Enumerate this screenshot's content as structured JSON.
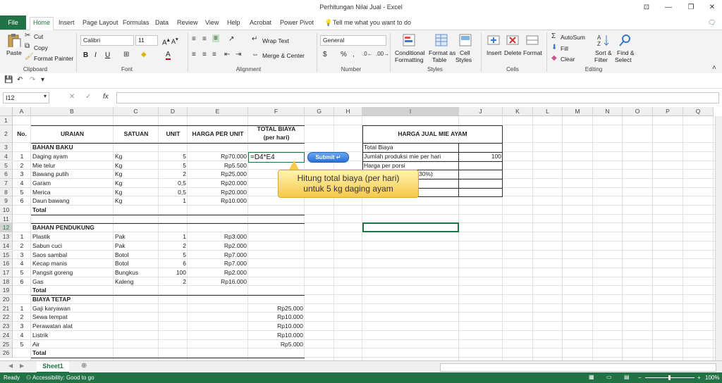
{
  "window": {
    "title": "Perhitungan Nilai Jual  -  Excel"
  },
  "tabs": [
    "File",
    "Home",
    "Insert",
    "Page Layout",
    "Formulas",
    "Data",
    "Review",
    "View",
    "Help",
    "Acrobat",
    "Power Pivot"
  ],
  "tell_me": "Tell me what you want to do",
  "ribbon": {
    "clipboard": {
      "label": "Clipboard",
      "paste": "Paste",
      "cut": "Cut",
      "copy": "Copy",
      "format_painter": "Format Painter"
    },
    "font": {
      "label": "Font",
      "name": "Calibri",
      "size": "11",
      "bold": "B",
      "italic": "I",
      "underline": "U"
    },
    "alignment": {
      "label": "Alignment",
      "wrap": "Wrap Text",
      "merge": "Merge & Center"
    },
    "number": {
      "label": "Number",
      "format": "General"
    },
    "styles": {
      "label": "Styles",
      "conditional": "Conditional",
      "formatting": "Formatting",
      "format_as": "Format as",
      "table": "Table",
      "cell": "Cell",
      "cell_styles": "Styles"
    },
    "cells": {
      "label": "Cells",
      "insert": "Insert",
      "delete": "Delete",
      "format": "Format"
    },
    "editing": {
      "label": "Editing",
      "autosum": "AutoSum",
      "fill": "Fill",
      "clear": "Clear",
      "sort": "Sort &",
      "filter": "Filter",
      "find": "Find &",
      "select": "Select"
    }
  },
  "namebox": "I12",
  "fx": "fx",
  "columns": [
    "A",
    "B",
    "C",
    "D",
    "E",
    "F",
    "G",
    "H",
    "I",
    "J",
    "K",
    "L",
    "M",
    "N",
    "O",
    "P",
    "Q"
  ],
  "rows": [
    "1",
    "2",
    "3",
    "4",
    "5",
    "6",
    "7",
    "8",
    "9",
    "10",
    "11",
    "12",
    "13",
    "14",
    "15",
    "16",
    "17",
    "18",
    "19",
    "20",
    "21",
    "22",
    "23",
    "24",
    "25",
    "26"
  ],
  "headers": {
    "no": "No.",
    "uraian": "URAIAN",
    "satuan": "SATUAN",
    "unit": "UNIT",
    "harga": "HARGA PER UNIT",
    "total1": "TOTAL BIAYA",
    "total2": "(per hari)"
  },
  "sections": {
    "bahan_baku": "BAHAN BAKU",
    "bahan_pendukung": "BAHAN PENDUKUNG",
    "biaya_tetap": "BIAYA TETAP",
    "total": "Total"
  },
  "bahan_baku": [
    {
      "no": "1",
      "item": "Daging ayam",
      "satuan": "Kg",
      "unit": "5",
      "harga": "Rp70.000"
    },
    {
      "no": "2",
      "item": "Mie telur",
      "satuan": "Kg",
      "unit": "5",
      "harga": "Rp5.500"
    },
    {
      "no": "3",
      "item": "Bawang putih",
      "satuan": "Kg",
      "unit": "2",
      "harga": "Rp25.000"
    },
    {
      "no": "4",
      "item": "Garam",
      "satuan": "Kg",
      "unit": "0,5",
      "harga": "Rp20.000"
    },
    {
      "no": "5",
      "item": "Merica",
      "satuan": "Kg",
      "unit": "0,5",
      "harga": "Rp20.000"
    },
    {
      "no": "6",
      "item": "Daun bawang",
      "satuan": "Kg",
      "unit": "1",
      "harga": "Rp10.000"
    }
  ],
  "bahan_pendukung": [
    {
      "no": "1",
      "item": "Plastik",
      "satuan": "Pak",
      "unit": "1",
      "harga": "Rp3.000"
    },
    {
      "no": "2",
      "item": "Sabun cuci",
      "satuan": "Pak",
      "unit": "2",
      "harga": "Rp2.000"
    },
    {
      "no": "3",
      "item": "Saos sambal",
      "satuan": "Botol",
      "unit": "5",
      "harga": "Rp7.000"
    },
    {
      "no": "4",
      "item": "Kecap manis",
      "satuan": "Botol",
      "unit": "6",
      "harga": "Rp7.000"
    },
    {
      "no": "5",
      "item": "Pangsit goreng",
      "satuan": "Bungkus",
      "unit": "100",
      "harga": "Rp2.000"
    },
    {
      "no": "6",
      "item": "Gas",
      "satuan": "Kaleng",
      "unit": "2",
      "harga": "Rp16.000"
    }
  ],
  "biaya_tetap": [
    {
      "no": "1",
      "item": "Gaji karyawan",
      "total": "Rp25.000"
    },
    {
      "no": "2",
      "item": "Sewa tempat",
      "total": "Rp10.000"
    },
    {
      "no": "3",
      "item": "Perawatan alat",
      "total": "Rp10.000"
    },
    {
      "no": "4",
      "item": "Listrik",
      "total": "Rp10.000"
    },
    {
      "no": "5",
      "item": "Air",
      "total": "Rp5.000"
    }
  ],
  "harga_jual": {
    "title": "HARGA JUAL MIE AYAM",
    "total_biaya": "Total Biaya",
    "produksi": "Jumlah produksi mie per hari",
    "produksi_val": "100",
    "harga_porsi": "Harga per porsi",
    "margin_partial": "30%)"
  },
  "editing_formula": "=D4*E4",
  "submit_label": "Submit ↵",
  "tooltip": {
    "line1": "Hitung total biaya (per hari)",
    "line2": "untuk 5 kg daging ayam"
  },
  "sheet_tab": "Sheet1",
  "status": {
    "ready": "Ready",
    "accessibility": "Accessibility: Good to go",
    "zoom": "100%"
  }
}
